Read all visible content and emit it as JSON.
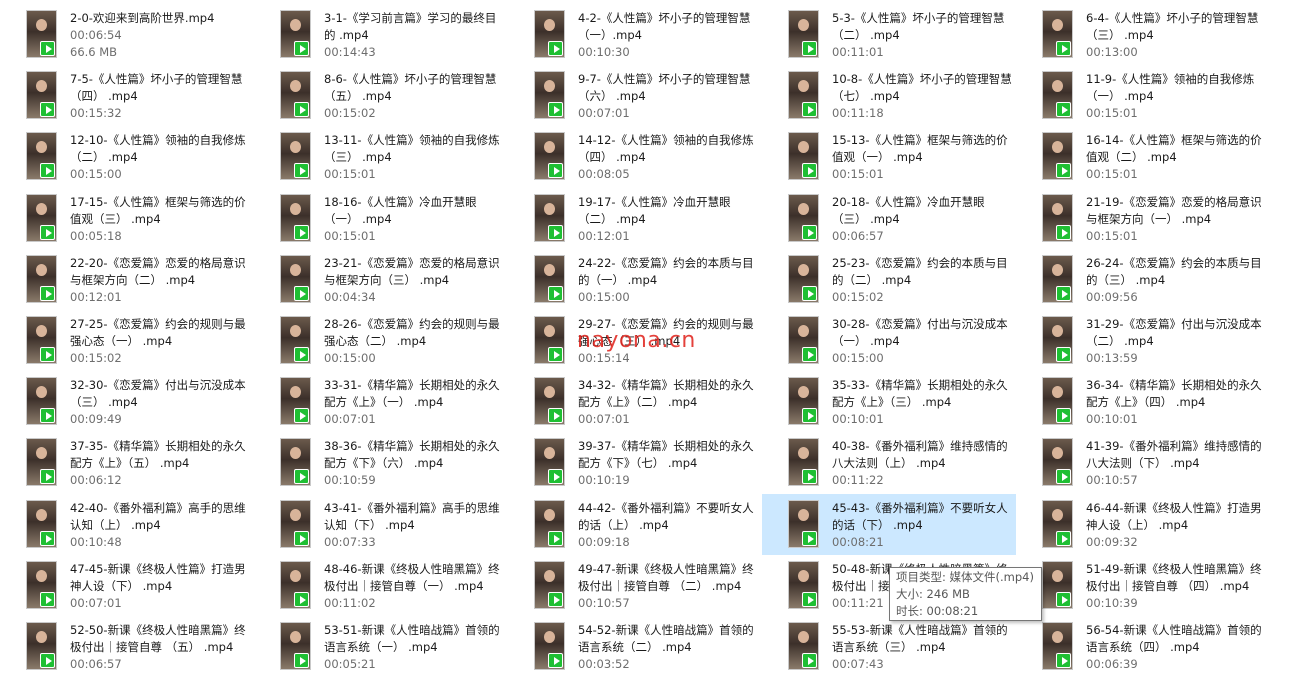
{
  "files": [
    {
      "name": "2-0-欢迎来到高阶世界.mp4",
      "duration": "00:06:54",
      "size": "66.6 MB"
    },
    {
      "name": "3-1-《学习前言篇》学习的最终目的 .mp4",
      "duration": "00:14:43"
    },
    {
      "name": "4-2-《人性篇》坏小子的管理智慧（一）.mp4",
      "duration": "00:10:30"
    },
    {
      "name": "5-3-《人性篇》坏小子的管理智慧（二） .mp4",
      "duration": "00:11:01"
    },
    {
      "name": "6-4-《人性篇》坏小子的管理智慧（三） .mp4",
      "duration": "00:13:00"
    },
    {
      "name": "7-5-《人性篇》坏小子的管理智慧（四） .mp4",
      "duration": "00:15:32"
    },
    {
      "name": "8-6-《人性篇》坏小子的管理智慧（五） .mp4",
      "duration": "00:15:02"
    },
    {
      "name": "9-7-《人性篇》坏小子的管理智慧（六） .mp4",
      "duration": "00:07:01"
    },
    {
      "name": "10-8-《人性篇》坏小子的管理智慧（七） .mp4",
      "duration": "00:11:18"
    },
    {
      "name": "11-9-《人性篇》领袖的自我修炼（一） .mp4",
      "duration": "00:15:01"
    },
    {
      "name": "12-10-《人性篇》领袖的自我修炼（二） .mp4",
      "duration": "00:15:00"
    },
    {
      "name": "13-11-《人性篇》领袖的自我修炼（三） .mp4",
      "duration": "00:15:01"
    },
    {
      "name": "14-12-《人性篇》领袖的自我修炼（四） .mp4",
      "duration": "00:08:05"
    },
    {
      "name": "15-13-《人性篇》框架与筛选的价值观（一） .mp4",
      "duration": "00:15:01"
    },
    {
      "name": "16-14-《人性篇》框架与筛选的价值观（二） .mp4",
      "duration": "00:15:01"
    },
    {
      "name": "17-15-《人性篇》框架与筛选的价值观（三） .mp4",
      "duration": "00:05:18"
    },
    {
      "name": "18-16-《人性篇》冷血开慧眼（一） .mp4",
      "duration": "00:15:01"
    },
    {
      "name": "19-17-《人性篇》冷血开慧眼（二） .mp4",
      "duration": "00:12:01"
    },
    {
      "name": "20-18-《人性篇》冷血开慧眼（三） .mp4",
      "duration": "00:06:57"
    },
    {
      "name": "21-19-《恋爱篇》恋爱的格局意识与框架方向（一） .mp4",
      "duration": "00:15:01"
    },
    {
      "name": "22-20-《恋爱篇》恋爱的格局意识与框架方向（二） .mp4",
      "duration": "00:12:01"
    },
    {
      "name": "23-21-《恋爱篇》恋爱的格局意识与框架方向（三） .mp4",
      "duration": "00:04:34"
    },
    {
      "name": "24-22-《恋爱篇》约会的本质与目的（一） .mp4",
      "duration": "00:15:00"
    },
    {
      "name": "25-23-《恋爱篇》约会的本质与目的（二） .mp4",
      "duration": "00:15:02"
    },
    {
      "name": "26-24-《恋爱篇》约会的本质与目的（三） .mp4",
      "duration": "00:09:56"
    },
    {
      "name": "27-25-《恋爱篇》约会的规则与最强心态（一） .mp4",
      "duration": "00:15:02"
    },
    {
      "name": "28-26-《恋爱篇》约会的规则与最强心态（二） .mp4",
      "duration": "00:15:00"
    },
    {
      "name": "29-27-《恋爱篇》约会的规则与最强心态（三） .mp4",
      "duration": "00:15:14"
    },
    {
      "name": "30-28-《恋爱篇》付出与沉没成本（一） .mp4",
      "duration": "00:15:00"
    },
    {
      "name": "31-29-《恋爱篇》付出与沉没成本（二） .mp4",
      "duration": "00:13:59"
    },
    {
      "name": "32-30-《恋爱篇》付出与沉没成本（三） .mp4",
      "duration": "00:09:49"
    },
    {
      "name": "33-31-《精华篇》长期相处的永久配方《上》（一） .mp4",
      "duration": "00:07:01"
    },
    {
      "name": "34-32-《精华篇》长期相处的永久配方《上》（二） .mp4",
      "duration": "00:07:01"
    },
    {
      "name": "35-33-《精华篇》长期相处的永久配方《上》（三） .mp4",
      "duration": "00:10:01"
    },
    {
      "name": "36-34-《精华篇》长期相处的永久配方《上》（四） .mp4",
      "duration": "00:10:01"
    },
    {
      "name": "37-35-《精华篇》长期相处的永久配方《上》（五） .mp4",
      "duration": "00:06:12"
    },
    {
      "name": "38-36-《精华篇》长期相处的永久配方《下》（六） .mp4",
      "duration": "00:10:59"
    },
    {
      "name": "39-37-《精华篇》长期相处的永久配方《下》（七） .mp4",
      "duration": "00:10:19"
    },
    {
      "name": "40-38-《番外福利篇》维持感情的八大法则（上） .mp4",
      "duration": "00:11:22"
    },
    {
      "name": "41-39-《番外福利篇》维持感情的八大法则（下） .mp4",
      "duration": "00:10:57"
    },
    {
      "name": "42-40-《番外福利篇》高手的思维认知（上） .mp4",
      "duration": "00:10:48"
    },
    {
      "name": "43-41-《番外福利篇》高手的思维认知（下） .mp4",
      "duration": "00:07:33"
    },
    {
      "name": "44-42-《番外福利篇》不要听女人的话（上） .mp4",
      "duration": "00:09:18"
    },
    {
      "name": "45-43-《番外福利篇》不要听女人的话（下） .mp4",
      "duration": "00:08:21"
    },
    {
      "name": "46-44-新课《终极人性篇》打造男神人设（上） .mp4",
      "duration": "00:09:32"
    },
    {
      "name": "47-45-新课《终极人性篇》打造男神人设（下） .mp4",
      "duration": "00:07:01"
    },
    {
      "name": "48-46-新课《终极人性暗黑篇》终极付出｜接管自尊（一） .mp4",
      "duration": "00:11:02"
    },
    {
      "name": "49-47-新课《终极人性暗黑篇》终极付出｜接管自尊 （二） .mp4",
      "duration": "00:10:57"
    },
    {
      "name": "50-48-新课《终极人性暗黑篇》终极付出｜接管自尊（三） .mp4",
      "duration": "00:11:21"
    },
    {
      "name": "51-49-新课《终极人性暗黑篇》终极付出｜接管自尊 （四） .mp4",
      "duration": "00:10:39"
    },
    {
      "name": "52-50-新课《终极人性暗黑篇》终极付出｜接管自尊 （五） .mp4",
      "duration": "00:06:57"
    },
    {
      "name": "53-51-新课《人性暗战篇》首领的语言系统（一） .mp4",
      "duration": "00:05:21"
    },
    {
      "name": "54-52-新课《人性暗战篇》首领的语言系统（二） .mp4",
      "duration": "00:03:52"
    },
    {
      "name": "55-53-新课《人性暗战篇》首领的语言系统（三） .mp4",
      "duration": "00:07:43"
    },
    {
      "name": "56-54-新课《人性暗战篇》首领的语言系统（四） .mp4",
      "duration": "00:06:39"
    }
  ],
  "selected_index": 43,
  "tooltip": {
    "type": "项目类型: 媒体文件(.mp4)",
    "size": "大小: 246 MB",
    "length": "时长: 00:08:21"
  },
  "watermark": "nayona.cn",
  "colors": {
    "selection": "#cce8ff",
    "badge": "#1fbf33",
    "watermark": "#e0201a"
  }
}
